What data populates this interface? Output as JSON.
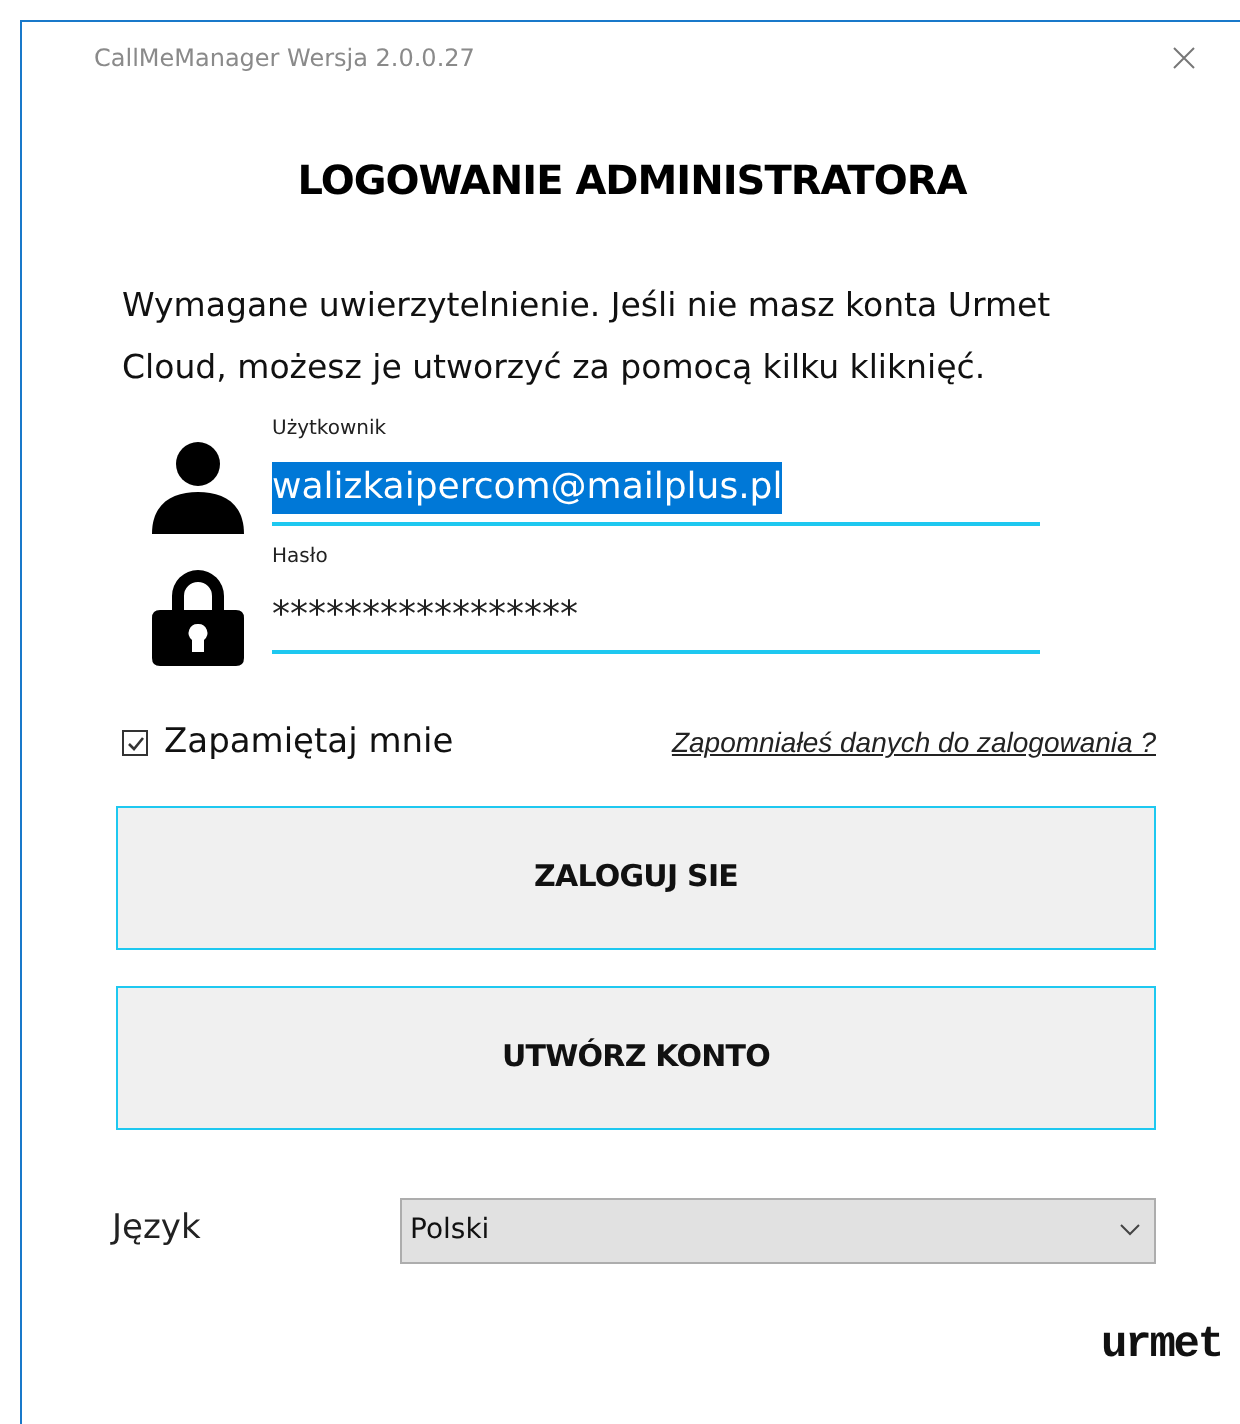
{
  "window": {
    "title": "CallMeManager Wersja 2.0.0.27"
  },
  "heading": "LOGOWANIE ADMINISTRATORA",
  "intro": "Wymagane uwierzytelnienie. Jeśli nie masz konta Urmet Cloud, możesz je utworzyć za pomocą kilku kliknięć.",
  "fields": [
    {
      "kind": "user",
      "label": "Użytkownik",
      "value": "walizkaipercom@mailplus.pl",
      "selected": true
    },
    {
      "kind": "password",
      "label": "Hasło",
      "value": "*****************",
      "selected": false
    }
  ],
  "remember": {
    "label": "Zapamiętaj mnie",
    "checked": true
  },
  "forgot_link": "Zapomniałeś danych do zalogowania ?",
  "buttons": [
    "ZALOGUJ SIE",
    "UTWÓRZ KONTO"
  ],
  "language": {
    "label": "Język",
    "value": "Polski"
  },
  "logo": "urmet"
}
